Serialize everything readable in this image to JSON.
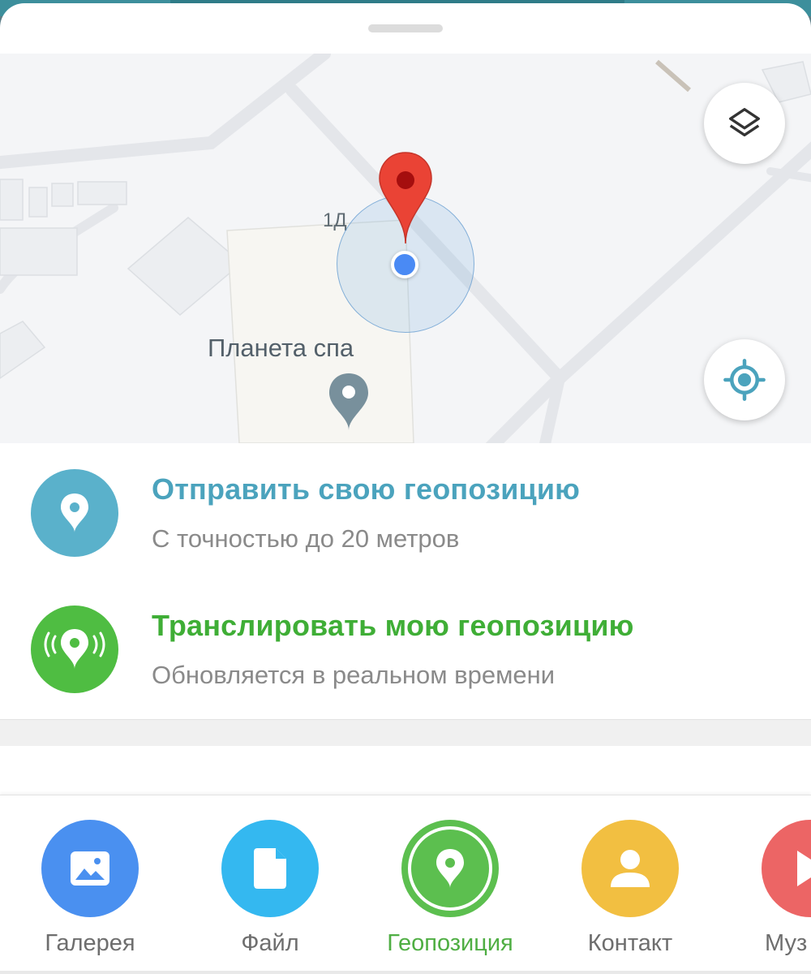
{
  "map": {
    "house_label": "1Д",
    "place_label": "Планета спа",
    "layers_button": "layers-icon",
    "locate_button": "crosshair-icon"
  },
  "options": {
    "send": {
      "title": "Отправить свою геопозицию",
      "subtitle": "С точностью до 20 метров",
      "color": "#5ab1cb"
    },
    "live": {
      "title": "Транслировать мою геопозицию",
      "subtitle": "Обновляется в реальном времени",
      "color": "#4fbd42"
    }
  },
  "attach_bar": {
    "items": [
      {
        "label": "Галерея",
        "icon": "image-icon",
        "color": "#4a90f0"
      },
      {
        "label": "Файл",
        "icon": "file-icon",
        "color": "#34b8f0"
      },
      {
        "label": "Геопозиция",
        "icon": "location-pin-icon",
        "color": "#5cbf4f",
        "selected": true
      },
      {
        "label": "Контакт",
        "icon": "person-icon",
        "color": "#f2bf41"
      },
      {
        "label": "Муз",
        "icon": "play-icon",
        "color": "#ec6565"
      }
    ]
  }
}
